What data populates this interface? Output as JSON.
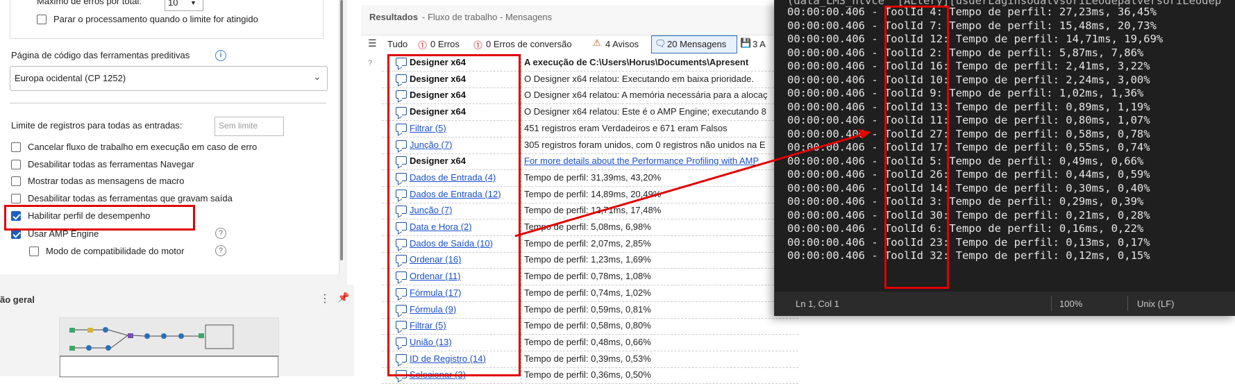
{
  "config": {
    "max_errors_label": "Máximo de erros por total:",
    "max_errors_value": "10",
    "stop_on_limit": "Parar o processamento quando o limite for atingido",
    "codepage_label": "Página de código das ferramentas preditivas",
    "codepage_value": "Europa ocidental (CP 1252)",
    "record_limit_label": "Limite de registros para todas as entradas:",
    "record_limit_placeholder": "Sem limite",
    "checkboxes": [
      {
        "label": "Cancelar fluxo de trabalho em execução em caso de erro",
        "checked": false
      },
      {
        "label": "Desabilitar todas as ferramentas Navegar",
        "checked": false
      },
      {
        "label": "Mostrar todas as mensagens de macro",
        "checked": false
      },
      {
        "label": "Desabilitar todas as ferramentas que gravam saída",
        "checked": false
      },
      {
        "label": "Habilitar perfil de desempenho",
        "checked": true
      },
      {
        "label": "Usar AMP Engine",
        "checked": true
      },
      {
        "label": "Modo de compatibilidade do motor",
        "checked": false
      }
    ],
    "overview_title": "ão geral"
  },
  "results": {
    "title": "Resultados",
    "subtitle": " - Fluxo de trabalho - Mensagens",
    "filters": {
      "all": "Tudo",
      "errors": "0 Erros",
      "conv_errors": "0 Erros de conversão",
      "warnings": "4 Avisos",
      "messages": "20 Mensagens",
      "files": "3 A"
    },
    "rows": [
      {
        "tool": "Designer x64",
        "style": "bold",
        "msg": "A execução de C:\\Users\\Horus\\Documents\\Apresent",
        "msgstyle": "b"
      },
      {
        "tool": "Designer x64",
        "style": "bold",
        "msg": "O Designer x64 relatou: Executando em baixa prioridade.",
        "msgstyle": ""
      },
      {
        "tool": "Designer x64",
        "style": "bold",
        "msg": "O Designer x64 relatou: A memória necessária para a alocaç",
        "msgstyle": ""
      },
      {
        "tool": "Designer x64",
        "style": "bold",
        "msg": "O Designer x64 relatou: Este é o AMP Engine; executando 8",
        "msgstyle": ""
      },
      {
        "tool": "Filtrar (5)",
        "style": "link",
        "msg": "451 registros eram Verdadeiros e 671 eram Falsos",
        "msgstyle": ""
      },
      {
        "tool": "Junção (7)",
        "style": "link",
        "msg": "305 registros foram unidos, com 0 registros não unidos na E",
        "msgstyle": ""
      },
      {
        "tool": "Designer x64",
        "style": "bold",
        "msg": "For more details about the Performance Profiling with AMP",
        "msgstyle": "link"
      },
      {
        "tool": "Dados de Entrada (4)",
        "style": "link",
        "msg": "Tempo de perfil: 31,39ms, 43,20%",
        "msgstyle": ""
      },
      {
        "tool": "Dados de Entrada (12)",
        "style": "link",
        "msg": "Tempo de perfil: 14,89ms, 20,49%",
        "msgstyle": ""
      },
      {
        "tool": "Junção (7)",
        "style": "link",
        "msg": "Tempo de perfil: 12,71ms, 17,48%",
        "msgstyle": ""
      },
      {
        "tool": "Data e Hora (2)",
        "style": "link",
        "msg": "Tempo de perfil: 5,08ms, 6,98%",
        "msgstyle": ""
      },
      {
        "tool": "Dados de Saída (10)",
        "style": "link",
        "msg": "Tempo de perfil: 2,07ms, 2,85%",
        "msgstyle": ""
      },
      {
        "tool": "Ordenar (16)",
        "style": "link",
        "msg": "Tempo de perfil: 1,23ms, 1,69%",
        "msgstyle": ""
      },
      {
        "tool": "Ordenar (11)",
        "style": "link",
        "msg": "Tempo de perfil: 0,78ms, 1,08%",
        "msgstyle": ""
      },
      {
        "tool": "Fórmula (17)",
        "style": "link",
        "msg": "Tempo de perfil: 0,74ms, 1,02%",
        "msgstyle": ""
      },
      {
        "tool": "Fórmula (9)",
        "style": "link",
        "msg": "Tempo de perfil: 0,59ms, 0,81%",
        "msgstyle": ""
      },
      {
        "tool": "Filtrar (5)",
        "style": "link",
        "msg": "Tempo de perfil: 0,58ms, 0,80%",
        "msgstyle": ""
      },
      {
        "tool": "União (13)",
        "style": "link",
        "msg": "Tempo de perfil: 0,48ms, 0,66%",
        "msgstyle": ""
      },
      {
        "tool": "ID de Registro (14)",
        "style": "link",
        "msg": "Tempo de perfil: 0,39ms, 0,53%",
        "msgstyle": ""
      },
      {
        "tool": "Selecionar (3)",
        "style": "link",
        "msg": "Tempo de perfil: 0,36ms, 0,50%",
        "msgstyle": ""
      }
    ]
  },
  "editor": {
    "top_line": "(data_LMS_ntvce  [ALtery][usderLaginsodalvsoriLeodepatversoriLeodep",
    "lines": [
      "00:00:00.406 - ToolId 4: Tempo de perfil: 27,23ms, 36,45%",
      "00:00:00.406 - ToolId 7: Tempo de perfil: 15,48ms, 20,73%",
      "00:00:00.406 - ToolId 12: Tempo de perfil: 14,71ms, 19,69%",
      "00:00:00.406 - ToolId 2: Tempo de perfil: 5,87ms, 7,86%",
      "00:00:00.406 - ToolId 16: Tempo de perfil: 2,41ms, 3,22%",
      "00:00:00.406 - ToolId 10: Tempo de perfil: 2,24ms, 3,00%",
      "00:00:00.406 - ToolId 9: Tempo de perfil: 1,02ms, 1,36%",
      "00:00:00.406 - ToolId 13: Tempo de perfil: 0,89ms, 1,19%",
      "00:00:00.406 - ToolId 11: Tempo de perfil: 0,80ms, 1,07%",
      "00:00:00.406 - ToolId 27: Tempo de perfil: 0,58ms, 0,78%",
      "00:00:00.406 - ToolId 17: Tempo de perfil: 0,55ms, 0,74%",
      "00:00:00.406 - ToolId 5: Tempo de perfil: 0,49ms, 0,66%",
      "00:00:00.406 - ToolId 26: Tempo de perfil: 0,44ms, 0,59%",
      "00:00:00.406 - ToolId 14: Tempo de perfil: 0,30ms, 0,40%",
      "00:00:00.406 - ToolId 3: Tempo de perfil: 0,29ms, 0,39%",
      "00:00:00.406 - ToolId 30: Tempo de perfil: 0,21ms, 0,28%",
      "00:00:00.406 - ToolId 6: Tempo de perfil: 0,16ms, 0,22%",
      "00:00:00.406 - ToolId 23: Tempo de perfil: 0,13ms, 0,17%",
      "00:00:00.406 - ToolId 32: Tempo de perfil: 0,12ms, 0,15%"
    ],
    "status_pos": "Ln 1, Col 1",
    "status_zoom": "100%",
    "status_eol": "Unix (LF)"
  },
  "colors": {
    "highlight": "#e00000",
    "link": "#1a4fd0",
    "accent": "#1d5fbf"
  }
}
